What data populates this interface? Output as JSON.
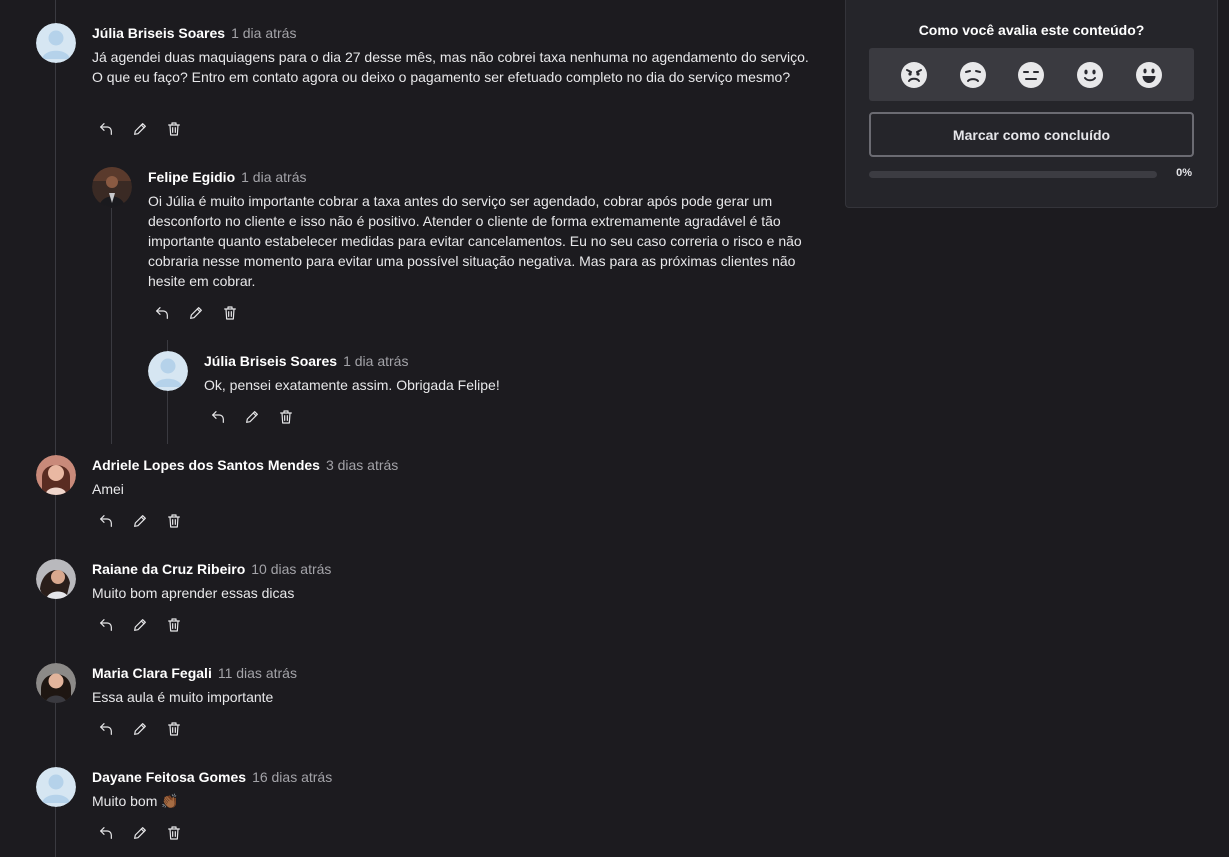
{
  "comments": [
    {
      "name": "Júlia Briseis Soares",
      "time": "1 dia atrás",
      "text": "Já agendei duas maquiagens para o dia 27 desse mês, mas não cobrei taxa nenhuma no agendamento do serviço. O que eu faço? Entro em contato agora ou deixo o pagamento ser efetuado completo no dia do serviço mesmo?"
    },
    {
      "name": "Felipe Egidio",
      "time": "1 dia atrás",
      "text": "Oi Júlia é muito importante cobrar a taxa antes do serviço ser agendado, cobrar após pode gerar um desconforto no cliente e isso não é positivo. Atender o cliente de forma extremamente agradável é tão importante quanto estabelecer medidas para evitar cancelamentos. Eu no seu caso correria o risco e não cobraria nesse momento para evitar uma possível situação negativa. Mas para as próximas clientes não hesite em cobrar."
    },
    {
      "name": "Júlia Briseis Soares",
      "time": "1 dia atrás",
      "text": "Ok, pensei exatamente assim. Obrigada Felipe!"
    },
    {
      "name": "Adriele Lopes dos Santos Mendes",
      "time": "3 dias atrás",
      "text": "Amei"
    },
    {
      "name": "Raiane da Cruz Ribeiro",
      "time": "10 dias atrás",
      "text": "Muito bom aprender essas dicas"
    },
    {
      "name": "Maria Clara Fegali",
      "time": "11 dias atrás",
      "text": "Essa aula é muito importante"
    },
    {
      "name": "Dayane Feitosa Gomes",
      "time": "16 dias atrás",
      "text": "Muito bom 👏🏾"
    }
  ],
  "icons": {
    "reply": "reply-icon",
    "edit": "pencil-icon",
    "delete": "trash-icon"
  },
  "rating": {
    "title": "Como você avalia este conteúdo?",
    "emojis": [
      "angry-face-icon",
      "sad-face-icon",
      "neutral-face-icon",
      "slight-smile-icon",
      "big-smile-icon"
    ],
    "complete_button": "Marcar como concluído",
    "progress_label": "0%",
    "progress_value": 0
  },
  "colors": {
    "background": "#1c1b1f",
    "panel": "#25252a",
    "text": "#e8e8ea",
    "muted": "#a3a3a8"
  }
}
